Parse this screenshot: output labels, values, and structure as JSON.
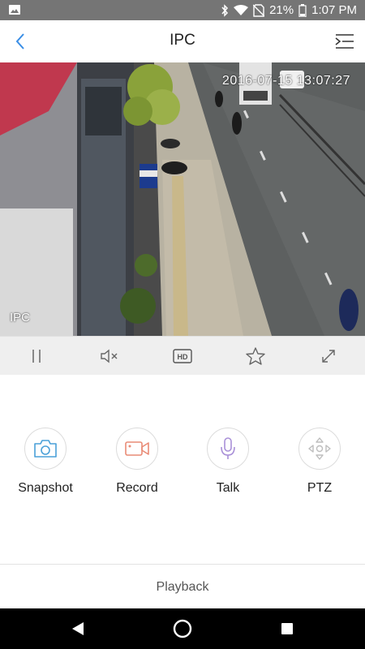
{
  "status_bar": {
    "battery_percent": "21%",
    "time": "1:07 PM",
    "icons": [
      "image-icon",
      "bluetooth-icon",
      "wifi-icon",
      "no-sim-icon",
      "battery-icon"
    ]
  },
  "header": {
    "title": "IPC",
    "back_icon": "chevron-left-icon",
    "menu_icon": "menu-collapse-icon",
    "accent_color": "#3a8ee6"
  },
  "video": {
    "timestamp": "2016-07-15 13:07:27",
    "camera_name": "IPC"
  },
  "controls": {
    "items": [
      {
        "name": "pause-button",
        "icon": "pause-icon"
      },
      {
        "name": "mute-button",
        "icon": "speaker-muted-icon"
      },
      {
        "name": "hd-button",
        "icon": "hd-icon",
        "label": "HD"
      },
      {
        "name": "favorite-button",
        "icon": "star-icon"
      },
      {
        "name": "fullscreen-button",
        "icon": "expand-icon"
      }
    ]
  },
  "actions": {
    "snapshot": {
      "label": "Snapshot",
      "icon": "camera-icon",
      "color": "#4aa0d8"
    },
    "record": {
      "label": "Record",
      "icon": "video-camera-icon",
      "color": "#e98b76"
    },
    "talk": {
      "label": "Talk",
      "icon": "microphone-icon",
      "color": "#a990d8"
    },
    "ptz": {
      "label": "PTZ",
      "icon": "direction-pad-icon",
      "color": "#bdbdbd"
    }
  },
  "footer": {
    "playback_label": "Playback"
  },
  "system_nav": {
    "icons": [
      "back-triangle-icon",
      "home-circle-icon",
      "recents-square-icon"
    ]
  }
}
